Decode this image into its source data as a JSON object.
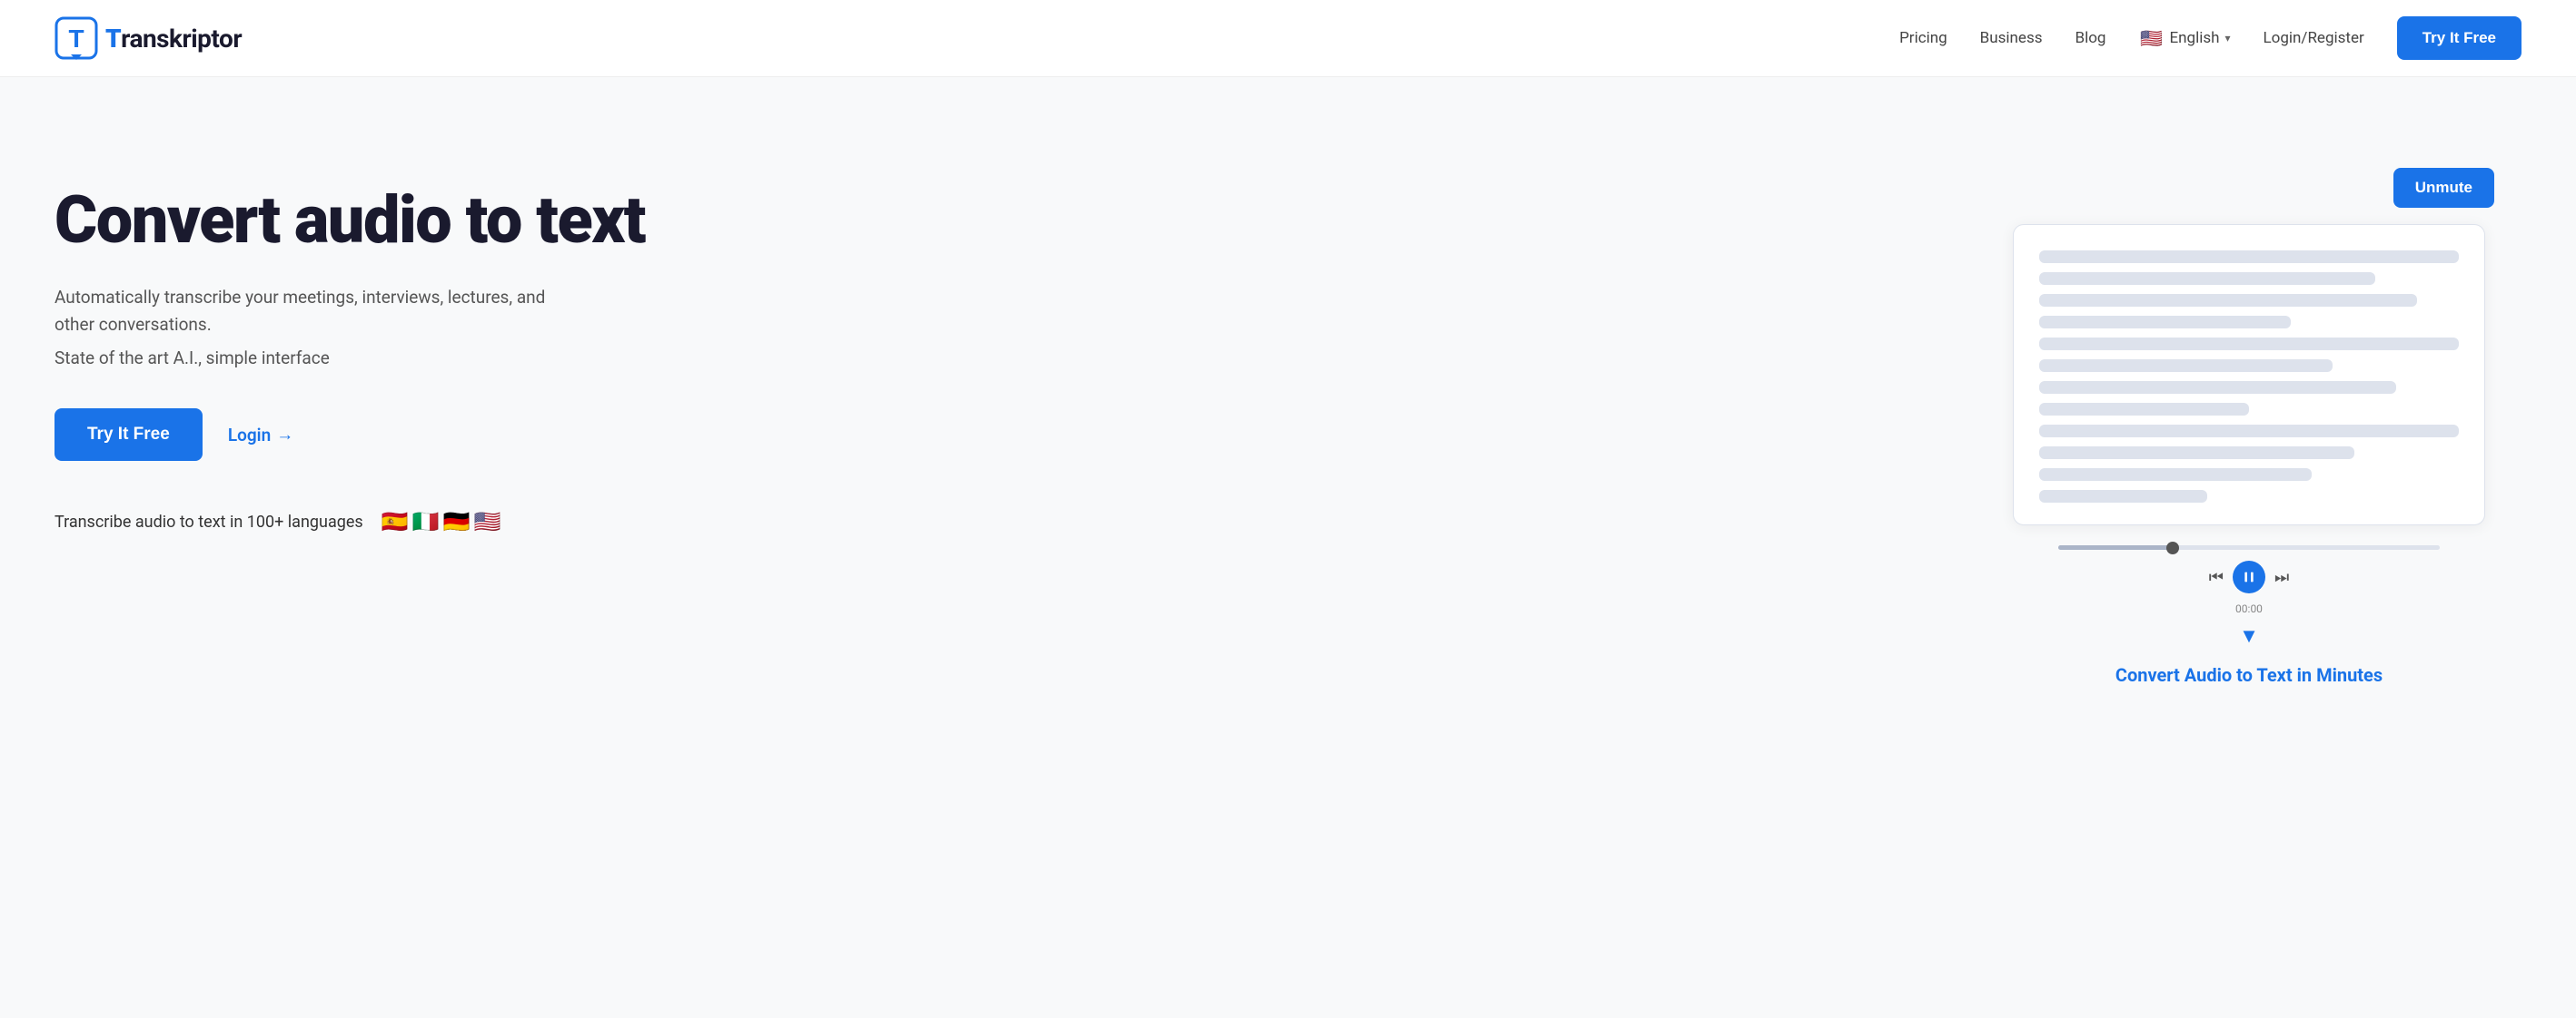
{
  "logo": {
    "icon_letter": "T",
    "brand_name_before": "",
    "brand_name": "Transkriptor",
    "url": "#"
  },
  "nav": {
    "links": [
      {
        "label": "Pricing",
        "href": "#"
      },
      {
        "label": "Business",
        "href": "#"
      },
      {
        "label": "Blog",
        "href": "#"
      }
    ],
    "language": {
      "flag": "🇺🇸",
      "label": "English"
    },
    "login_label": "Login/Register",
    "cta_label": "Try It Free"
  },
  "hero": {
    "title": "Convert audio to text",
    "subtitle": "Automatically transcribe your meetings, interviews, lectures, and other conversations.",
    "tagline": "State of the art A.I., simple interface",
    "cta_label": "Try It Free",
    "login_label": "Login",
    "login_arrow": "→",
    "languages_text": "Transcribe audio to text in 100+ languages",
    "language_flags": [
      "🇪🇸",
      "🇮🇹",
      "🇩🇪",
      "🇺🇸"
    ],
    "unmute_label": "Unmute",
    "convert_caption": "Convert Audio to Text in Minutes",
    "player": {
      "time": "00:00"
    }
  }
}
